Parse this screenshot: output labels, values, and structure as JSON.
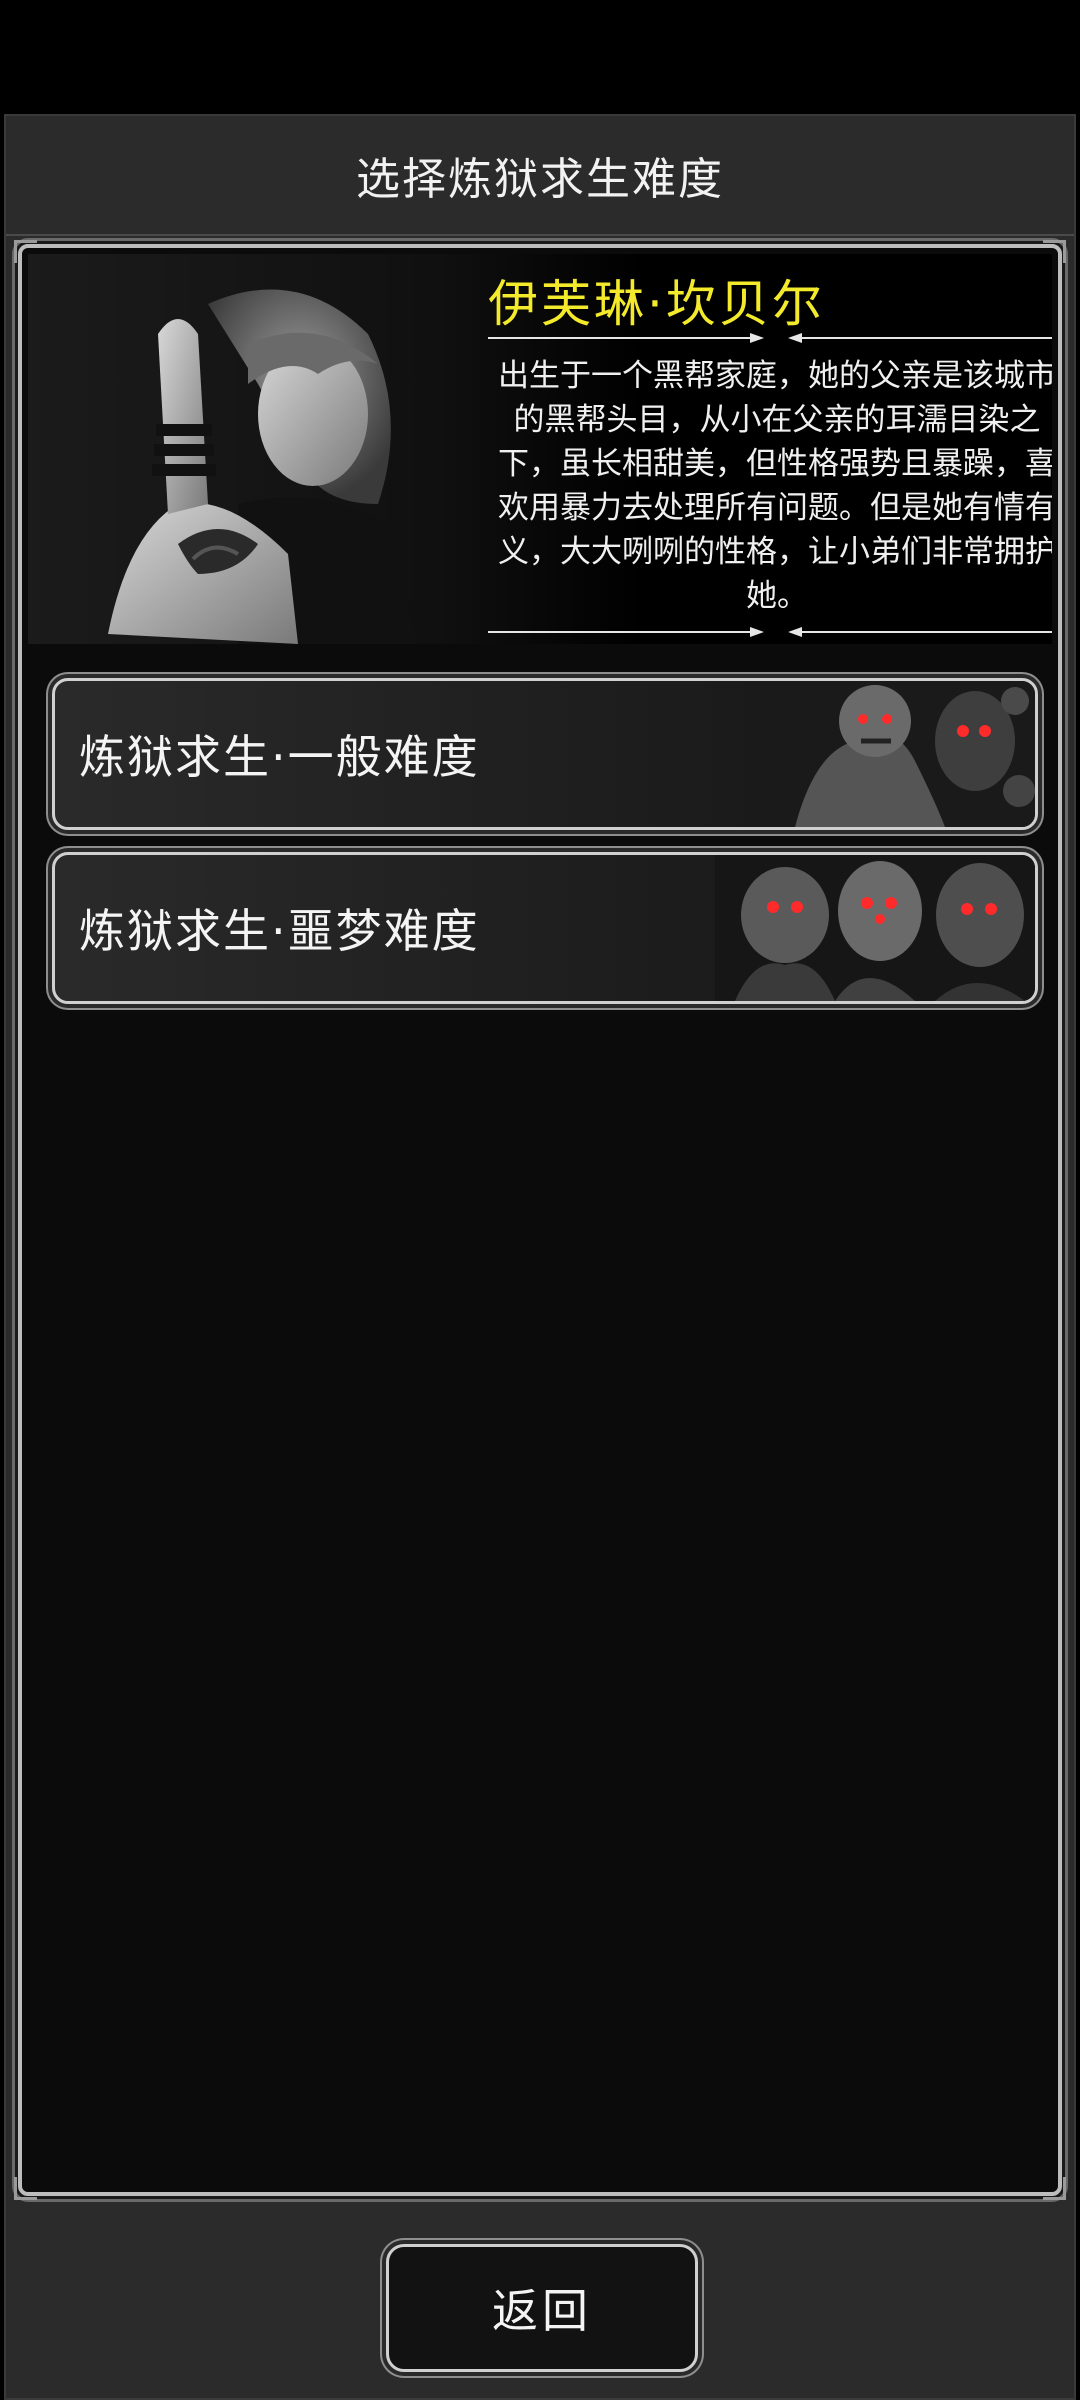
{
  "header": {
    "title": "选择炼狱求生难度"
  },
  "character": {
    "name": "伊芙琳·坎贝尔",
    "description": "出生于一个黑帮家庭，她的父亲是该城市的黑帮头目，从小在父亲的耳濡目染之下，虽长相甜美，但性格强势且暴躁，喜欢用暴力去处理所有问题。但是她有情有义，大大咧咧的性格，让小弟们非常拥护她。",
    "name_color": "#f3ea2c"
  },
  "difficulties": [
    {
      "label": "炼狱求生·一般难度"
    },
    {
      "label": "炼狱求生·噩梦难度"
    }
  ],
  "footer": {
    "back_label": "返回"
  }
}
